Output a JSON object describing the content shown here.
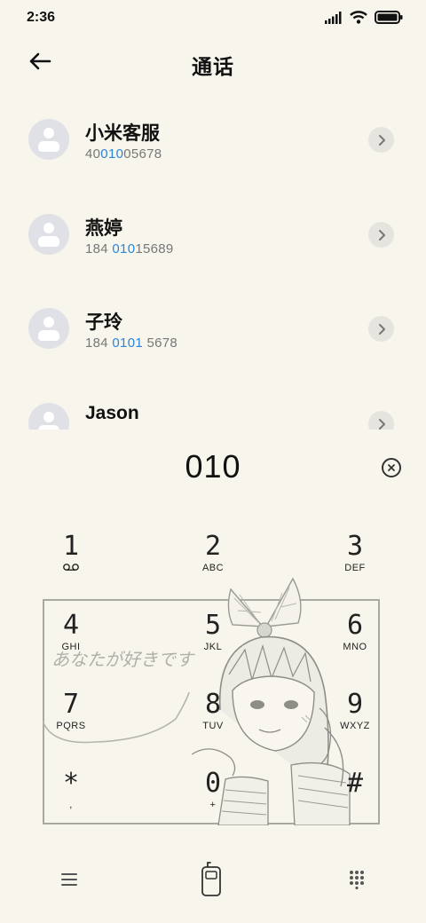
{
  "status_bar": {
    "time": "2:36"
  },
  "header": {
    "title": "通话"
  },
  "contacts": [
    {
      "name": "小米客服",
      "number_pre": "40",
      "number_match": "010",
      "number_post": "05678"
    },
    {
      "name": "燕婷",
      "number_pre": "184 ",
      "number_match": "010",
      "number_post": "15689"
    },
    {
      "name": "子玲",
      "number_pre": "184 ",
      "number_match": "0101",
      "number_post": " 5678"
    },
    {
      "name": "Jason",
      "number_pre": "",
      "number_match": "",
      "number_post": ""
    }
  ],
  "dial": {
    "entered": "010"
  },
  "keypad": [
    {
      "digit": "1",
      "letters": ""
    },
    {
      "digit": "2",
      "letters": "ABC"
    },
    {
      "digit": "3",
      "letters": "DEF"
    },
    {
      "digit": "4",
      "letters": "GHI"
    },
    {
      "digit": "5",
      "letters": "JKL"
    },
    {
      "digit": "6",
      "letters": "MNO"
    },
    {
      "digit": "7",
      "letters": "PQRS"
    },
    {
      "digit": "8",
      "letters": "TUV"
    },
    {
      "digit": "9",
      "letters": "WXYZ"
    },
    {
      "digit": "*",
      "letters": ","
    },
    {
      "digit": "0",
      "letters": "+"
    },
    {
      "digit": "#",
      "letters": ""
    }
  ],
  "theme": {
    "caption": "あなたが好きです"
  },
  "colors": {
    "background": "#f8f5ec",
    "highlight": "#2a86d8",
    "avatar": "#dfe1e6"
  },
  "icons": {
    "back": "arrow-left-icon",
    "clear": "clear-icon",
    "voicemail": "voicemail-icon",
    "menu": "menu-icon",
    "call": "phone-call-icon",
    "keypad_toggle": "dialpad-icon"
  }
}
